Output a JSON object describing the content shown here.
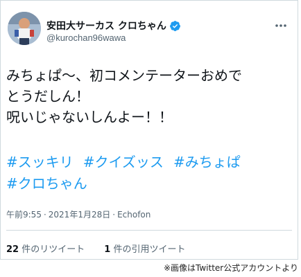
{
  "tweet": {
    "display_name": "安田大サーカス クロちゃん",
    "handle": "@kurochan96wawa",
    "text_lines": [
      "みちょぱ〜、初コメンテーターおめで",
      "とうだしん！",
      "呪いじゃないしんよー！！"
    ],
    "hashtags": [
      "#スッキリ",
      "#クイズッス",
      "#みちょぱ",
      "#クロちゃん"
    ],
    "time": "午前9:55",
    "separator": "·",
    "date": "2021年1月28日",
    "source": "Echofon",
    "retweets": {
      "count": "22",
      "label": "件のリツイート"
    },
    "quotes": {
      "count": "1",
      "label": "件の引用ツイート"
    }
  },
  "credit": "※画像はTwitter公式アカウントより",
  "colors": {
    "accent": "#1d9bf0",
    "text": "#0f1419",
    "muted": "#536471"
  },
  "icons": {
    "verified": "verified-badge-icon",
    "more": "more-dots-icon"
  }
}
